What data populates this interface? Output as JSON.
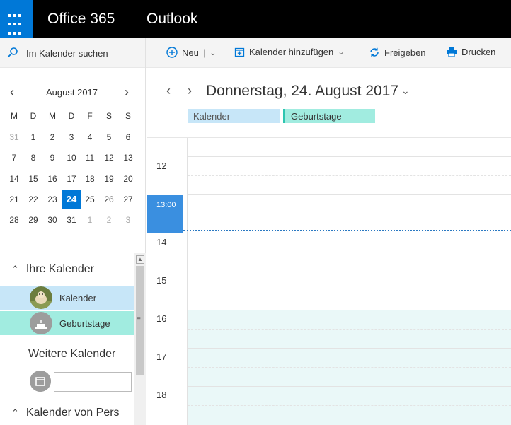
{
  "topbar": {
    "brand": "Office 365",
    "app": "Outlook"
  },
  "commandbar": {
    "search_placeholder": "Im Kalender suchen",
    "new_label": "Neu",
    "add_calendar_label": "Kalender hinzufügen",
    "share_label": "Freigeben",
    "print_label": "Drucken"
  },
  "minicalendar": {
    "month_title": "August 2017",
    "weekdays": [
      "M",
      "D",
      "M",
      "D",
      "F",
      "S",
      "S"
    ],
    "weeks": [
      [
        "31",
        "1",
        "2",
        "3",
        "4",
        "5",
        "6"
      ],
      [
        "7",
        "8",
        "9",
        "10",
        "11",
        "12",
        "13"
      ],
      [
        "14",
        "15",
        "16",
        "17",
        "18",
        "19",
        "20"
      ],
      [
        "21",
        "22",
        "23",
        "24",
        "25",
        "26",
        "27"
      ],
      [
        "28",
        "29",
        "30",
        "31",
        "1",
        "2",
        "3"
      ]
    ],
    "today": "24"
  },
  "sidebar": {
    "my_calendars_heading": "Ihre Kalender",
    "calendars": [
      {
        "label": "Kalender",
        "color": "#c7e6f8"
      },
      {
        "label": "Geburtstage",
        "color": "#a1ece0"
      }
    ],
    "more_calendars_heading": "Weitere Kalender",
    "people_calendars_heading": "Kalender von Pers"
  },
  "main": {
    "date_title": "Donnerstag, 24. August 2017",
    "calendar_tags": [
      "Kalender",
      "Geburtstage"
    ],
    "hours": [
      "12",
      "14",
      "15",
      "16",
      "17",
      "18"
    ],
    "current_time": "13:00"
  },
  "colors": {
    "accent": "#0078d7",
    "now_badge": "#3a8fe0",
    "today_bg": "#0078d7",
    "birthday_tint": "#eaf8f8"
  }
}
